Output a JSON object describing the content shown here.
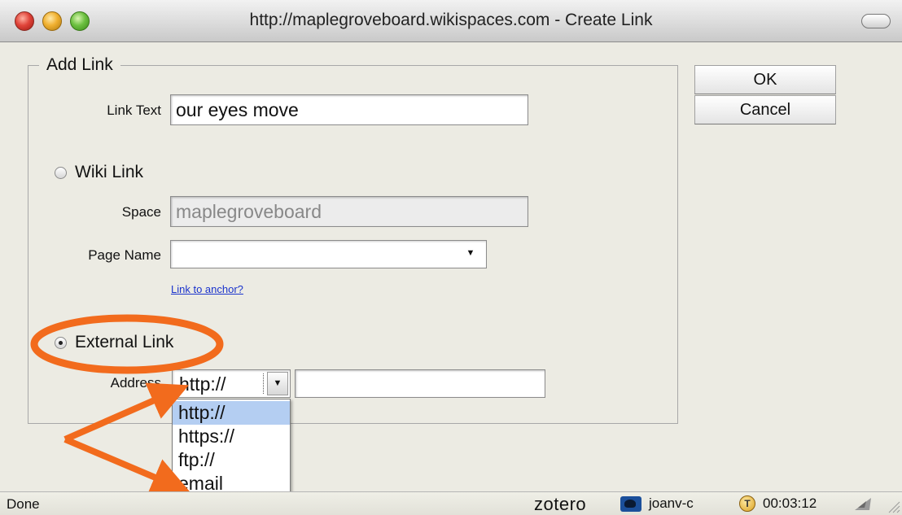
{
  "window": {
    "title": "http://maplegroveboard.wikispaces.com - Create Link"
  },
  "fieldset": {
    "legend": "Add Link"
  },
  "link_text": {
    "label": "Link Text",
    "value": "our eyes move"
  },
  "wiki_link": {
    "label": "Wiki Link",
    "selected": false,
    "space_label": "Space",
    "space_value": "maplegroveboard",
    "page_name_label": "Page Name",
    "page_name_value": "",
    "anchor_link": "Link to anchor?"
  },
  "external_link": {
    "label": "External Link",
    "selected": true,
    "address_label": "Address",
    "protocol_value": "http://",
    "address_value": "",
    "protocol_options": [
      "http://",
      "https://",
      "ftp://",
      "email"
    ],
    "highlighted_option": "http://"
  },
  "buttons": {
    "ok": "OK",
    "cancel": "Cancel"
  },
  "statusbar": {
    "status": "Done",
    "zotero": "zotero",
    "user": "joanv-c",
    "timer_icon": "T",
    "timer": "00:03:12"
  },
  "colors": {
    "annotation": "#f26b1d",
    "selection": "#b4cef2",
    "link": "#1a33cc"
  }
}
